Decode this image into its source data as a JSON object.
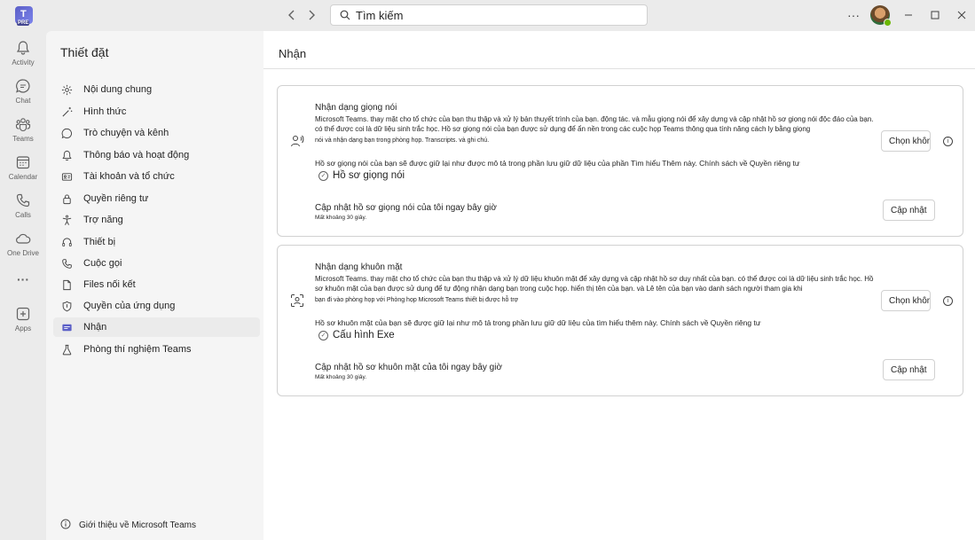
{
  "titlebar": {
    "search_placeholder": "Tìm kiếm",
    "more_label": "···"
  },
  "rail": {
    "items": [
      {
        "label": "Activity",
        "icon": "bell-icon"
      },
      {
        "label": "Chat",
        "icon": "chat-icon"
      },
      {
        "label": "Teams",
        "icon": "teams-icon"
      },
      {
        "label": "Calendar",
        "icon": "calendar-icon"
      },
      {
        "label": "Calls",
        "icon": "phone-icon"
      },
      {
        "label": "One Drive",
        "icon": "cloud-icon"
      },
      {
        "label": "Apps",
        "icon": "add-app-icon"
      }
    ],
    "more_label": "···"
  },
  "sidebar": {
    "title": "Thiết đặt",
    "items": [
      {
        "label": "Nội dung chung",
        "icon": "gear-icon"
      },
      {
        "label": "Hình thức",
        "icon": "wand-icon"
      },
      {
        "label": "Trò chuyện và kênh",
        "icon": "chat-icon"
      },
      {
        "label": "Thông báo và hoạt động",
        "icon": "bell-icon"
      },
      {
        "label": "Tài khoản và tổ chức",
        "icon": "id-card-icon"
      },
      {
        "label": "Quyền riêng tư",
        "icon": "lock-icon"
      },
      {
        "label": "Trợ năng",
        "icon": "accessibility-icon"
      },
      {
        "label": "Thiết bị",
        "icon": "headset-icon"
      },
      {
        "label": "Cuộc gọi",
        "icon": "phone-icon"
      },
      {
        "label": "Files nối kết",
        "icon": "file-icon"
      },
      {
        "label": "Quyền của ứng dụng",
        "icon": "shield-icon"
      },
      {
        "label": "Nhận",
        "icon": "recognition-icon"
      },
      {
        "label": "Phòng thí nghiệm Teams",
        "icon": "flask-icon"
      }
    ],
    "active_index": 11,
    "about_label": "Giới thiệu về Microsoft Teams"
  },
  "main": {
    "title": "Nhận",
    "voice": {
      "title": "Nhận dạng giọng nói",
      "desc": "Microsoft Teams. thay mặt cho tổ chức của bạn thu thập và xử lý bản thuyết trình của bạn. động tác. và mẫu giọng nói để xây dựng và cập nhật hồ sơ giọng nói độc đáo của bạn. có thể được coi là dữ liệu sinh trắc học. Hồ sơ giọng nói của bạn được sử dụng để ẩn nền trong các cuộc họp Teams thông qua tính năng cách ly bằng giọng",
      "fine": "nói và nhận dạng bạn trong phòng họp. Transcripts. và ghi chú.",
      "retention": "Hồ sơ giọng nói của bạn sẽ được giữ lại như được mô tả trong phần lưu giữ dữ liệu của phần Tìm hiểu Thêm này. Chính sách về Quyền riêng tư",
      "chip": "Hồ sơ giọng nói",
      "optout_button": "Chọn không tham gia",
      "update_title": "Cập nhật hồ sơ giọng nói của tôi ngay bây giờ",
      "update_note": "Mất khoảng 30 giây.",
      "update_button": "Cập nhật"
    },
    "face": {
      "title": "Nhận dạng khuôn mặt",
      "desc": "Microsoft Teams. thay mặt cho tổ chức của bạn thu thập và xử lý dữ liệu khuôn mặt để xây dựng và cập nhật hồ sơ duy nhất của bạn. có thể được coi là dữ liệu sinh trắc học. Hồ sơ khuôn mặt của bạn được sử dụng để tự động nhận dạng bạn trong cuộc họp. hiển thị tên của bạn. và Lê tên của bạn vào danh sách người tham gia khi",
      "fine": "bạn đi vào phòng họp với Phòng họp Microsoft Teams thiết bị được hỗ trợ",
      "retention": "Hồ sơ khuôn mặt của bạn sẽ được giữ lại như mô tả trong phần lưu giữ dữ liệu của tìm hiểu thêm này. Chính sách về Quyền riêng tư",
      "chip": "Cấu hình Exe",
      "optout_button": "Chọn không tham gia",
      "update_title": "Cập nhật hồ sơ khuôn mặt của tôi ngay bây giờ",
      "update_note": "Mất khoảng 30 giây.",
      "update_button": "Cập nhật"
    }
  }
}
